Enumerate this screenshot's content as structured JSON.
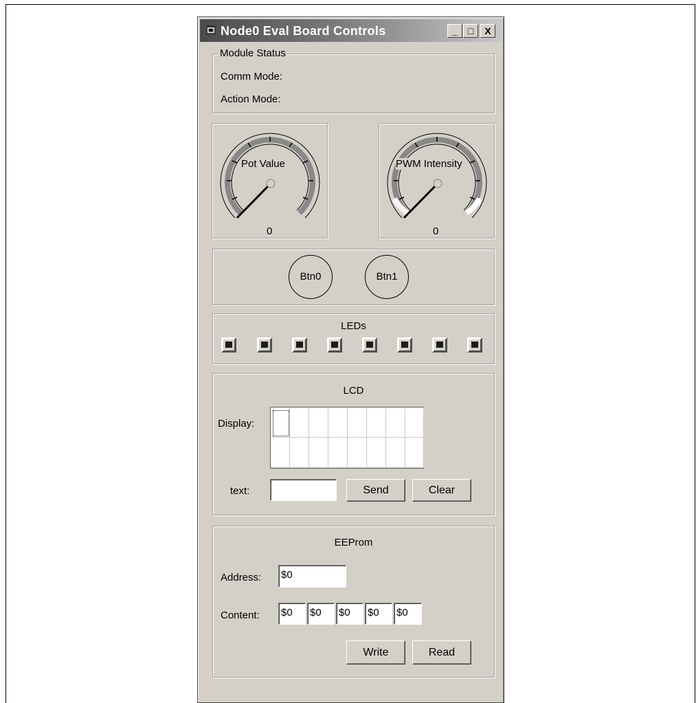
{
  "window": {
    "title": "Node0 Eval Board Controls",
    "minimize": "_",
    "maximize": "□",
    "close": "X"
  },
  "module_status": {
    "legend": "Module Status",
    "comm_mode_label": "Comm Mode:",
    "action_mode_label": "Action Mode:"
  },
  "gauges": {
    "pot": {
      "label": "Pot Value",
      "value": "0"
    },
    "pwm": {
      "label": "PWM Intensity",
      "value": "0"
    }
  },
  "buttons": {
    "btn0": "Btn0",
    "btn1": "Btn1"
  },
  "leds": {
    "title": "LEDs",
    "count": 8
  },
  "lcd": {
    "title": "LCD",
    "display_label": "Display:",
    "text_label": "text:",
    "text_value": "",
    "send": "Send",
    "clear": "Clear",
    "columns": 8,
    "rows": 2
  },
  "eeprom": {
    "title": "EEProm",
    "address_label": "Address:",
    "address_value": "$0",
    "content_label": "Content:",
    "content_values": [
      "$0",
      "$0",
      "$0",
      "$0",
      "$0"
    ],
    "write": "Write",
    "read": "Read"
  },
  "colors": {
    "window_bg": "#d4d0c8",
    "title_dark": "#4a4a4a"
  }
}
